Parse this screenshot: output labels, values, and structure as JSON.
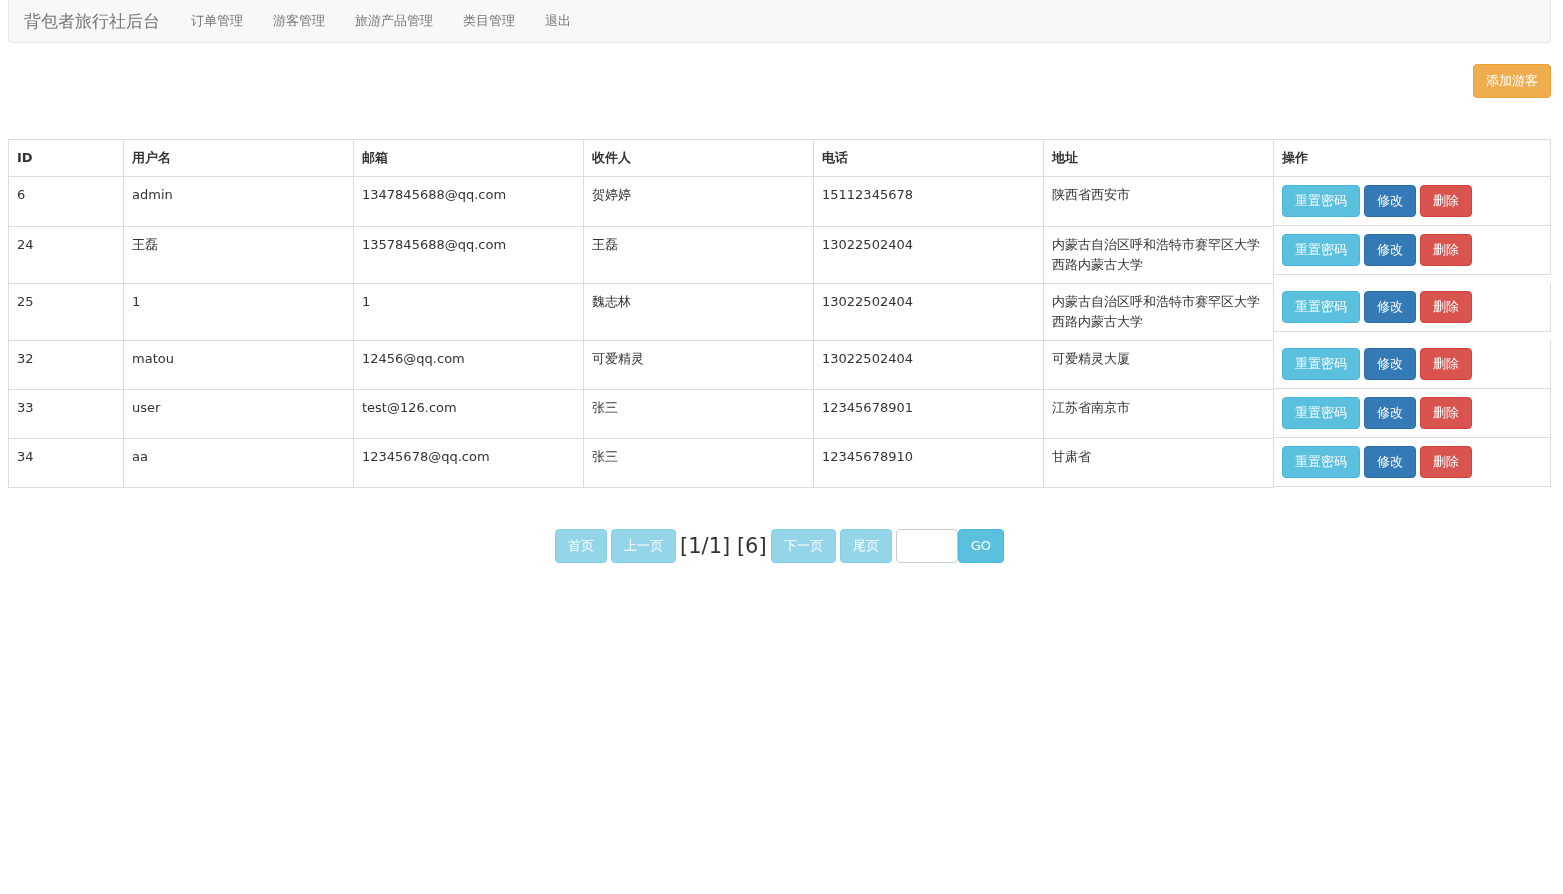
{
  "navbar": {
    "brand": "背包者旅行社后台",
    "links": [
      "订单管理",
      "游客管理",
      "旅游产品管理",
      "类目管理",
      "退出"
    ]
  },
  "add_button": "添加游客",
  "table": {
    "columns": [
      "ID",
      "用户名",
      "邮箱",
      "收件人",
      "电话",
      "地址",
      "操作"
    ],
    "rows": [
      {
        "cells": [
          "6",
          "admin",
          "1347845688@qq.com",
          "贺婷婷",
          "15112345678",
          "陕西省西安市"
        ],
        "actions": [
          {
            "label": "重置密码",
            "kind": "info"
          },
          {
            "label": "修改",
            "kind": "primary"
          },
          {
            "label": "删除",
            "kind": "danger"
          }
        ]
      },
      {
        "cells": [
          "24",
          "王磊",
          "1357845688@qq.com",
          "王磊",
          "13022502404",
          "内蒙古自治区呼和浩特市赛罕区大学西路内蒙古大学"
        ],
        "actions": [
          {
            "label": "重置密码",
            "kind": "info"
          },
          {
            "label": "修改",
            "kind": "primary"
          },
          {
            "label": "删除",
            "kind": "danger"
          }
        ]
      },
      {
        "cells": [
          "25",
          "1",
          "1",
          "魏志林",
          "13022502404",
          "内蒙古自治区呼和浩特市赛罕区大学西路内蒙古大学"
        ],
        "actions": [
          {
            "label": "重置密码",
            "kind": "info"
          },
          {
            "label": "修改",
            "kind": "primary"
          },
          {
            "label": "删除",
            "kind": "danger"
          }
        ]
      },
      {
        "cells": [
          "32",
          "matou",
          "12456@qq.com",
          "可爱精灵",
          "13022502404",
          "可爱精灵大厦"
        ],
        "actions": [
          {
            "label": "重置密码",
            "kind": "info"
          },
          {
            "label": "修改",
            "kind": "primary"
          },
          {
            "label": "删除",
            "kind": "danger"
          }
        ]
      },
      {
        "cells": [
          "33",
          "user",
          "test@126.com",
          "张三",
          "12345678901",
          "江苏省南京市"
        ],
        "actions": [
          {
            "label": "重置密码",
            "kind": "info"
          },
          {
            "label": "修改",
            "kind": "primary"
          },
          {
            "label": "删除",
            "kind": "danger"
          }
        ]
      },
      {
        "cells": [
          "34",
          "aa",
          "12345678@qq.com",
          "张三",
          "12345678910",
          "甘肃省"
        ],
        "actions": [
          {
            "label": "重置密码",
            "kind": "info"
          },
          {
            "label": "修改",
            "kind": "primary"
          },
          {
            "label": "删除",
            "kind": "danger"
          }
        ]
      }
    ]
  },
  "pagination": {
    "before": [
      {
        "label": "首页",
        "disabled": true
      },
      {
        "label": "上一页",
        "disabled": true
      }
    ],
    "info": "[1/1] [6]",
    "after": [
      {
        "label": "下一页",
        "disabled": true
      },
      {
        "label": "尾页",
        "disabled": true
      }
    ],
    "go": "GO"
  }
}
